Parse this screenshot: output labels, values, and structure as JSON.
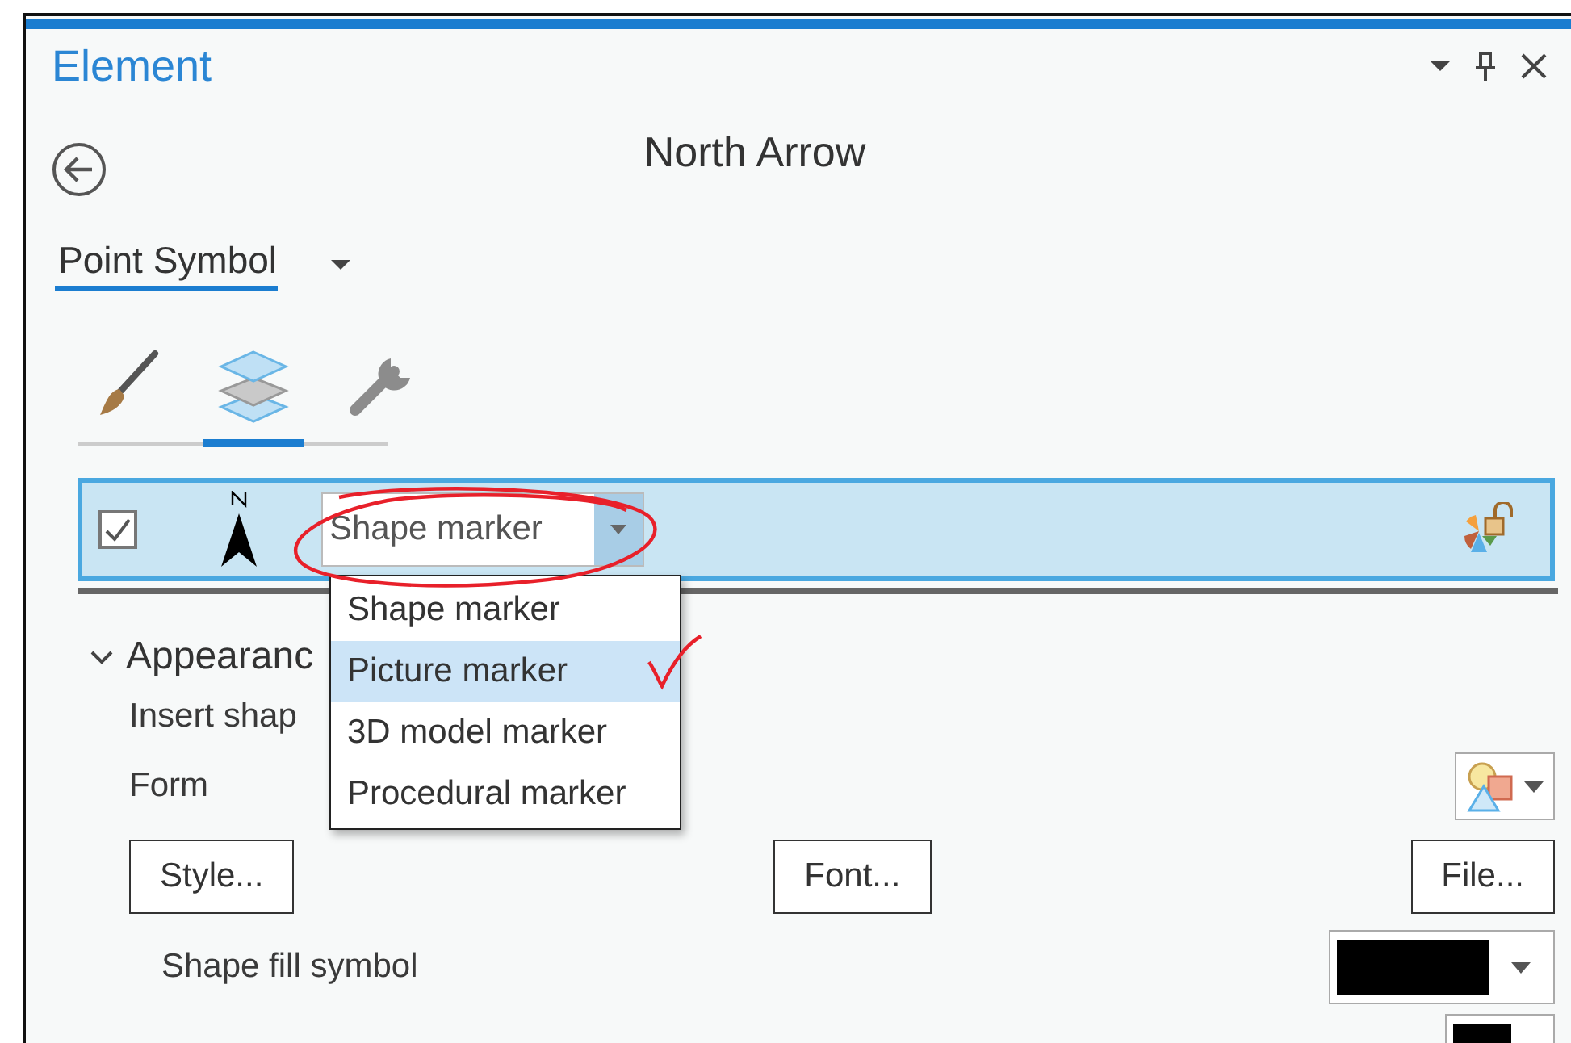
{
  "panel": {
    "title": "Element",
    "heading": "North Arrow",
    "symbol_type": "Point Symbol"
  },
  "tabs": [
    {
      "kind": "brush",
      "selected": false
    },
    {
      "kind": "layers",
      "selected": true
    },
    {
      "kind": "wrench",
      "selected": false
    }
  ],
  "layer": {
    "visible": true,
    "marker_type": "Shape marker"
  },
  "menu": [
    {
      "label": "Shape marker",
      "selected": false
    },
    {
      "label": "Picture marker",
      "selected": true
    },
    {
      "label": "3D model marker",
      "selected": false
    },
    {
      "label": "Procedural marker",
      "selected": false
    }
  ],
  "section": {
    "title": "Appearanc",
    "expanded": true
  },
  "rows": [
    {
      "kind": "label",
      "label": "Insert shap"
    },
    {
      "kind": "picker",
      "label": "Form"
    },
    {
      "kind": "buttons",
      "buttons": [
        "Style...",
        "Font...",
        "File..."
      ]
    },
    {
      "kind": "swatch",
      "label": "Shape fill symbol",
      "color": "#000000"
    },
    {
      "kind": "swatch",
      "color": "#000000"
    }
  ]
}
